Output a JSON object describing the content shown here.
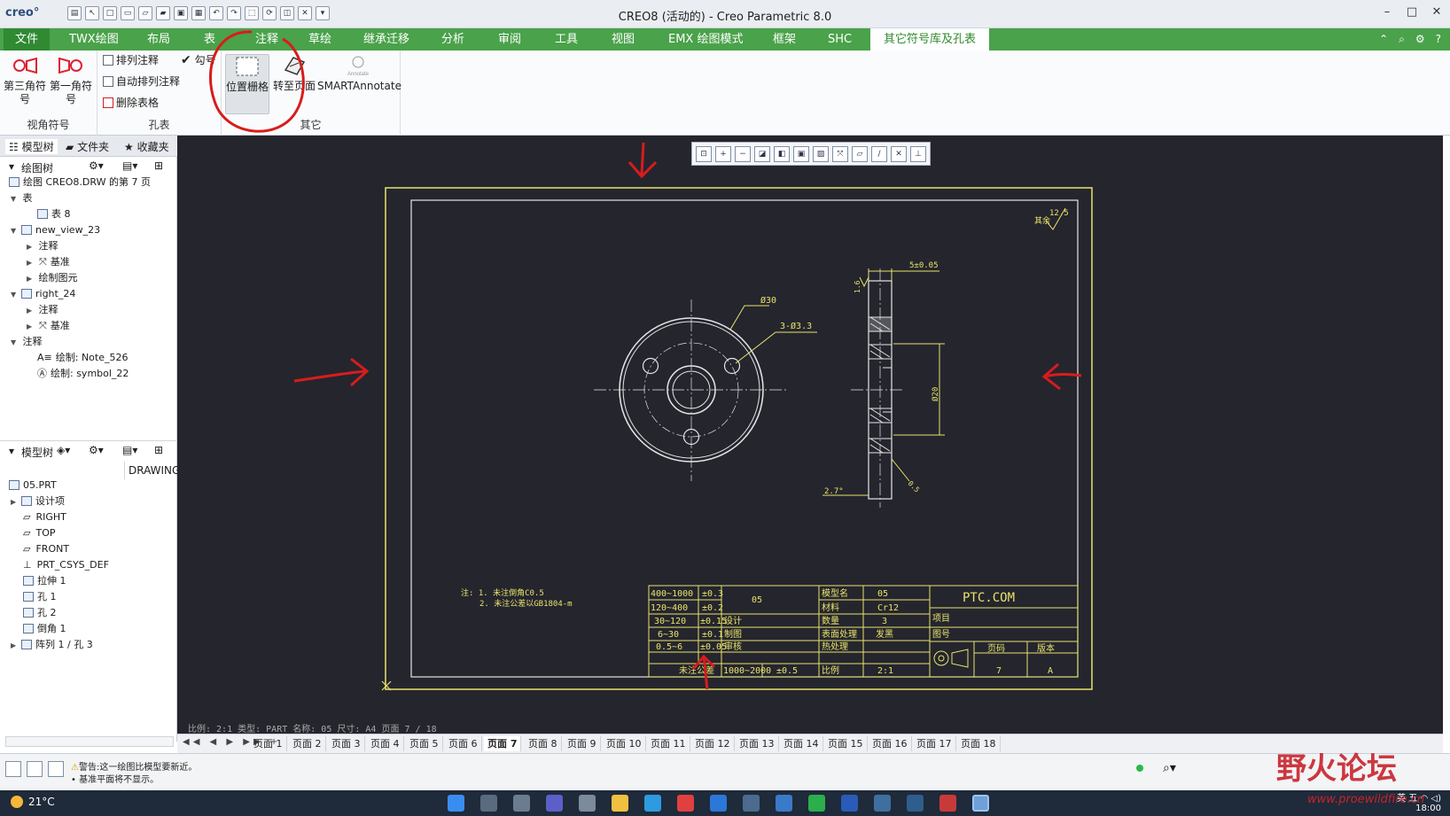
{
  "app": {
    "logo": "creo°",
    "title": "CREO8 (活动的) - Creo Parametric 8.0"
  },
  "colors": {
    "ribbon_green": "#4aa24a",
    "drawing_yellow": "#e8e46a",
    "drawing_white": "#e6e6e6",
    "annotation_red": "#d81c1c",
    "graphics_bg": "#25252e"
  },
  "tabs": [
    "文件",
    "TWX绘图",
    "布局",
    "表",
    "注释",
    "草绘",
    "继承迁移",
    "分析",
    "审阅",
    "工具",
    "视图",
    "EMX 绘图模式",
    "框架",
    "SHC",
    "其它符号库及孔表"
  ],
  "ribbon": {
    "view_symbol": {
      "btn1": "第三角符号",
      "btn2": "第一角符号",
      "group": "视角符号"
    },
    "hole_table": {
      "b1": "排列注释",
      "b2": "自动排列注释",
      "b3": "删除表格",
      "group": "孔表",
      "check": "勾号"
    },
    "other": {
      "b1": "位置栅格",
      "b2": "转至页面",
      "b3": "SMARTAnnotate",
      "b3_small": "Annotate",
      "group": "其它"
    }
  },
  "left_tabs": [
    "模型树",
    "文件夹",
    "收藏夹"
  ],
  "drawing_tree": {
    "header": "绘图树",
    "nodes": [
      "绘图 CREO8.DRW 的第 7 页",
      "表",
      "表 8",
      "new_view_23",
      "注释",
      "基准",
      "绘制图元",
      "right_24",
      "注释",
      "基准",
      "注释",
      "绘制: Note_526",
      "绘制: symbol_22"
    ]
  },
  "model_tree": {
    "header": "模型树",
    "drawing_label": "DRAWING",
    "nodes": [
      "05.PRT",
      "设计项",
      "RIGHT",
      "TOP",
      "FRONT",
      "PRT_CSYS_DEF",
      "拉伸 1",
      "孔 1",
      "孔 2",
      "倒角 1",
      "阵列 1 / 孔 3"
    ]
  },
  "drawing": {
    "roughness_value": "12.5",
    "roughness_label": "其余",
    "dims": {
      "d30": "Ø30",
      "holes": "3-Ø3.3",
      "d20": "Ø20",
      "thickness": "5±0.05",
      "rough16": "1.6",
      "chamfer": "0.5",
      "angle": "2.7°"
    },
    "notes": [
      "注: 1. 未注倒角C0.5",
      "2. 未注公差以GB1804-m"
    ],
    "tolerance_table": [
      [
        "400~1000",
        "±0.3"
      ],
      [
        "120~400",
        "±0.2"
      ],
      [
        "30~120",
        "±0.15"
      ],
      [
        "6~30",
        "±0.1"
      ],
      [
        "0.5~6",
        "±0.05"
      ]
    ],
    "tol_footer": [
      "未注公差",
      "1000~2000",
      "±0.5"
    ],
    "part_no": "05",
    "sign": [
      "设计",
      "制图",
      "审核"
    ],
    "attrs": [
      [
        "模型名",
        "05"
      ],
      [
        "材料",
        "Cr12"
      ],
      [
        "数量",
        "3"
      ],
      [
        "表面处理",
        "发黑"
      ],
      [
        "热处理",
        ""
      ],
      [
        "比例",
        "2:1"
      ]
    ],
    "company": "PTC.COM",
    "proj": "项目",
    "drawno": "图号",
    "page_label": "页码",
    "page_val": "7",
    "rev_label": "版本",
    "rev_val": "A"
  },
  "graphics_status": "比例: 2:1    类型: PART   名称: 05   尺寸: A4   页面 7 / 18",
  "pages": [
    "页面 1",
    "页面 2",
    "页面 3",
    "页面 4",
    "页面 5",
    "页面 6",
    "页面 7",
    "页面 8",
    "页面 9",
    "页面 10",
    "页面 11",
    "页面 12",
    "页面 13",
    "页面 14",
    "页面 15",
    "页面 16",
    "页面 17",
    "页面 18"
  ],
  "active_page": "页面 7",
  "messages": [
    "警告:这一绘图比模型要新近。",
    "• 基准平面将不显示。"
  ],
  "weather": "21°C",
  "tray": {
    "time": "18:00",
    "ime1": "英",
    "ime2": "五"
  },
  "watermark": {
    "text": "野火论坛",
    "url": "www.proewildfire.cn"
  }
}
